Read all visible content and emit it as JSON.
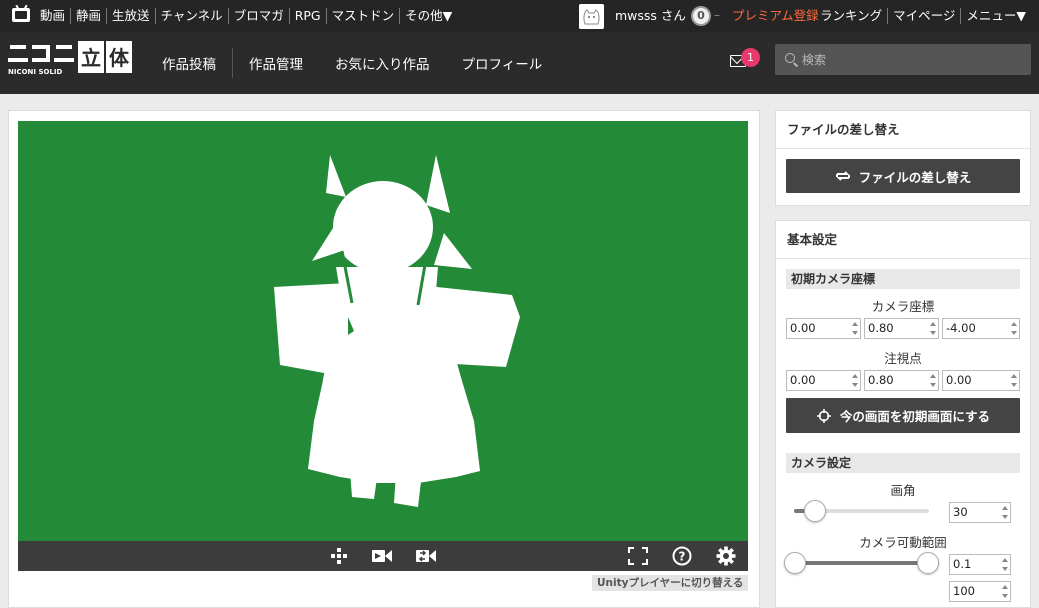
{
  "topbar": {
    "links": [
      "動画",
      "静画",
      "生放送",
      "チャンネル",
      "ブロマガ",
      "RPG",
      "マストドン",
      "その他▼"
    ],
    "username": "mwsss さん",
    "points": "0",
    "premium": "プレミアム登録",
    "right_links": [
      "ランキング",
      "マイページ",
      "メニュー▼"
    ]
  },
  "header": {
    "logo_text": "NICONI SOLID",
    "nav": [
      "作品投稿",
      "作品管理",
      "お気に入り作品",
      "プロフィール"
    ],
    "mail_count": "1",
    "search_placeholder": "検索"
  },
  "viewer": {
    "background_color": "#238a38",
    "unity_switch": "Unityプレイヤーに切り替える",
    "controls": [
      "move-icon",
      "camera-reset-icon",
      "camera-set-icon",
      "fullscreen-icon",
      "help-icon",
      "gear-icon"
    ]
  },
  "file_panel": {
    "title": "ファイルの差し替え",
    "button": "ファイルの差し替え"
  },
  "basic_panel": {
    "title": "基本設定",
    "initial_camera": {
      "heading": "初期カメラ座標",
      "camera_pos_label": "カメラ座標",
      "camera_pos": [
        "0.00",
        "0.80",
        "-4.00"
      ],
      "look_at_label": "注視点",
      "look_at": [
        "0.00",
        "0.80",
        "0.00"
      ],
      "set_button": "今の画面を初期画面にする"
    },
    "camera_settings": {
      "heading": "カメラ設定",
      "fov_label": "画角",
      "fov_value": "30",
      "range_label": "カメラ可動範囲",
      "range_min": "0.1",
      "range_max": "100"
    }
  }
}
